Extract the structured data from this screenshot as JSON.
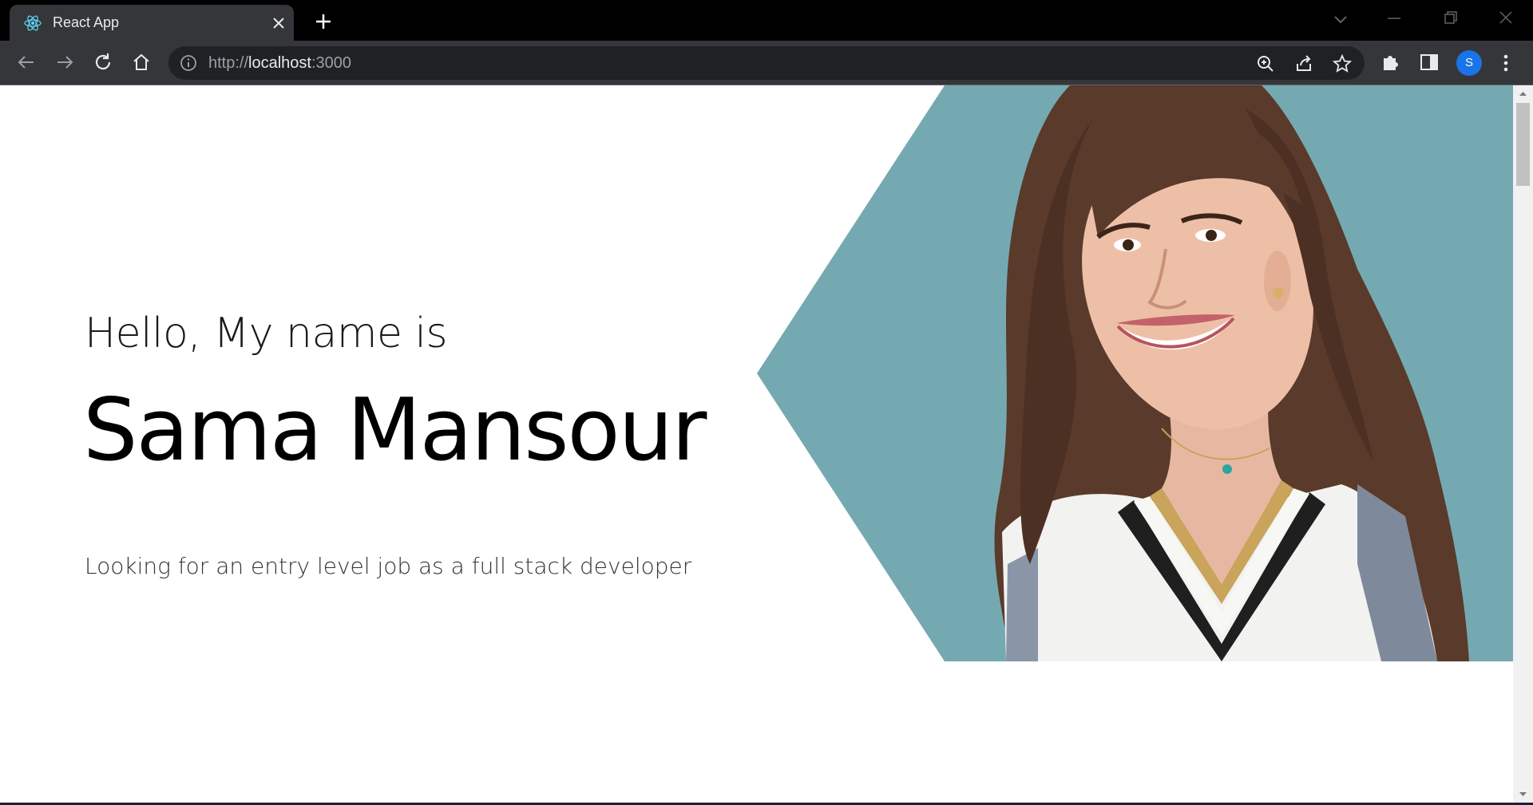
{
  "browser": {
    "tab": {
      "title": "React App",
      "favicon": "react-logo-icon"
    },
    "address_bar": {
      "scheme": "http://",
      "host": "localhost",
      "port": ":3000"
    },
    "profile": {
      "initial": "S",
      "color": "#1a73e8"
    }
  },
  "hero": {
    "greeting": "Hello, My name is",
    "name": "Sama Mansour",
    "tagline": "Looking for an entry level job as a full stack developer",
    "accent_color": "#75a9b2",
    "photo_description_icon": "portrait-photo"
  }
}
